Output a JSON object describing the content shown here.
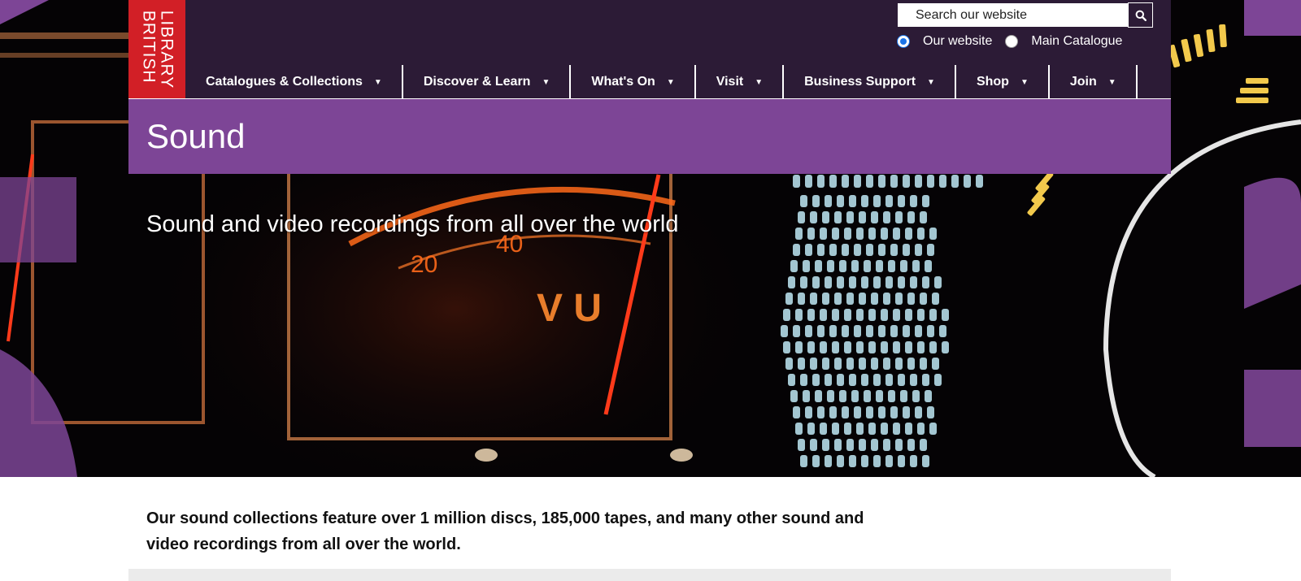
{
  "logo": {
    "line1": "LIBRARY",
    "line2": "BRITISH",
    "color": "#d21f26"
  },
  "search": {
    "placeholder": "Search our website",
    "button_icon": "search-icon"
  },
  "search_scope": {
    "options": [
      {
        "label": "Our website",
        "checked": true
      },
      {
        "label": "Main Catalogue",
        "checked": false
      }
    ]
  },
  "nav": {
    "items": [
      {
        "label": "Catalogues & Collections"
      },
      {
        "label": "Discover & Learn"
      },
      {
        "label": "What's On"
      },
      {
        "label": "Visit"
      },
      {
        "label": "Business Support"
      },
      {
        "label": "Shop"
      },
      {
        "label": "Join"
      }
    ]
  },
  "page": {
    "title": "Sound",
    "tagline": "Sound and video recordings from all over the world",
    "intro": "Our sound collections feature over 1 million discs, 185,000 tapes, and many other sound and video recordings from all over the world."
  },
  "colors": {
    "topbar": "#2c1b36",
    "banner": "#7d4596",
    "accent_red": "#d21f26"
  }
}
